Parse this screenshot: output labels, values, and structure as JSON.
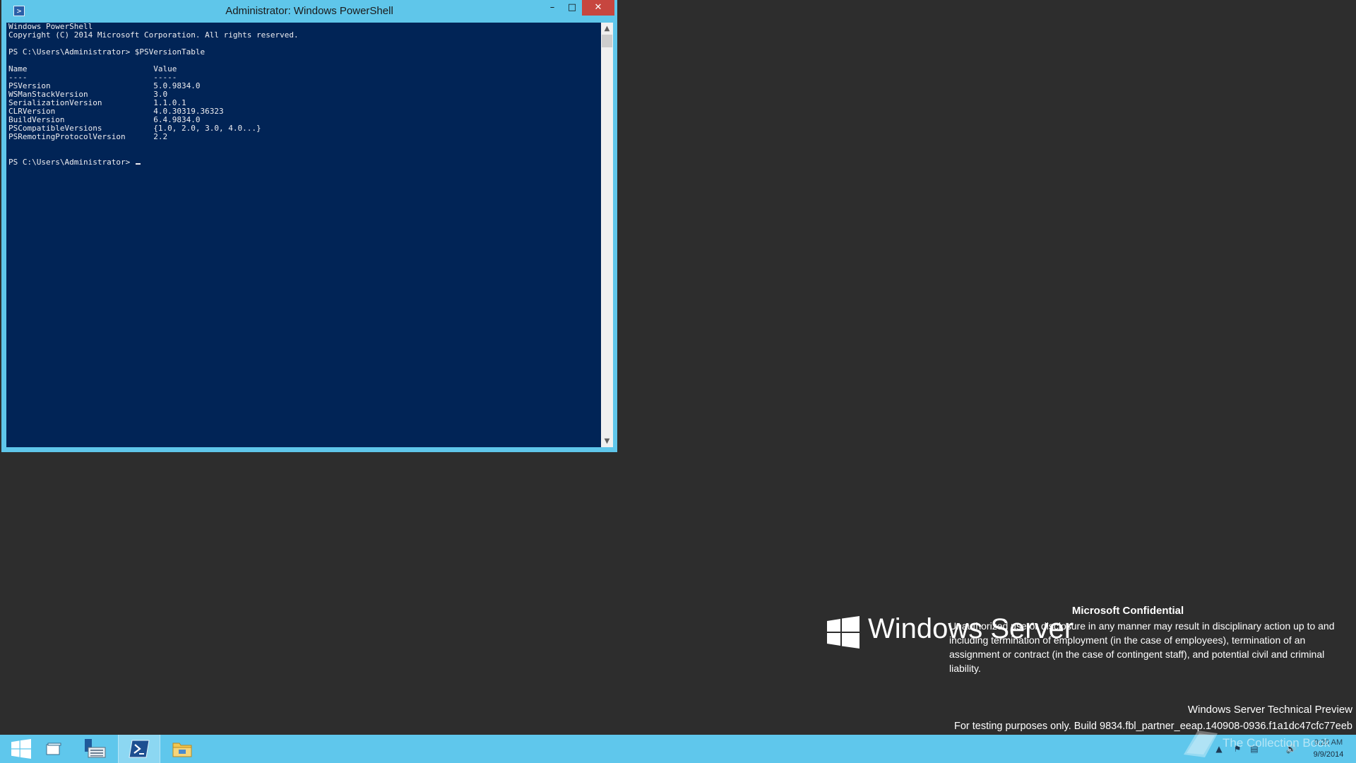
{
  "window": {
    "title": "Administrator: Windows PowerShell",
    "minimize_glyph": "–",
    "maximize_glyph": "□",
    "close_glyph": "✕"
  },
  "console": {
    "lines": [
      "Windows PowerShell",
      "Copyright (C) 2014 Microsoft Corporation. All rights reserved.",
      "",
      "PS C:\\Users\\Administrator> $PSVersionTable",
      "",
      "Name                           Value",
      "----                           -----",
      "PSVersion                      5.0.9834.0",
      "WSManStackVersion              3.0",
      "SerializationVersion           1.1.0.1",
      "CLRVersion                     4.0.30319.36323",
      "BuildVersion                   6.4.9834.0",
      "PSCompatibleVersions           {1.0, 2.0, 3.0, 4.0...}",
      "PSRemotingProtocolVersion      2.2",
      "",
      ""
    ],
    "prompt": "PS C:\\Users\\Administrator> "
  },
  "desktop": {
    "brand": "Windows Server",
    "confidential_title": "Microsoft Confidential",
    "confidential_body": "Unauthorized use or disclosure in any manner may result in disciplinary action up to and including termination of employment (in the case of employees), termination of an assignment or contract (in the case of contingent staff), and potential civil and criminal liability.",
    "edition": "Windows Server Technical Preview",
    "build": "For testing purposes only. Build 9834.fbl_partner_eeap.140908-0936.f1a1dc47cfc77eeb"
  },
  "taskbar": {
    "items": [
      {
        "name": "start-button",
        "icon": "windows-logo-icon",
        "active": false
      },
      {
        "name": "taskbar-task-view",
        "icon": "window-icon",
        "active": false
      },
      {
        "name": "taskbar-server-manager",
        "icon": "server-manager-icon",
        "active": false
      },
      {
        "name": "taskbar-powershell",
        "icon": "powershell-icon",
        "active": true
      },
      {
        "name": "taskbar-file-explorer",
        "icon": "folder-icon",
        "active": false
      }
    ],
    "clock_time": "9:20 AM",
    "clock_date": "9/9/2014",
    "watermark": "The Collection Book"
  },
  "colors": {
    "console_bg": "#012456",
    "console_text": "#eeedf0",
    "window_frame": "#5fc6ea",
    "desktop_bg": "#2d2d2d",
    "taskbar_bg": "#5fc7ec",
    "close_button": "#c7463f"
  }
}
